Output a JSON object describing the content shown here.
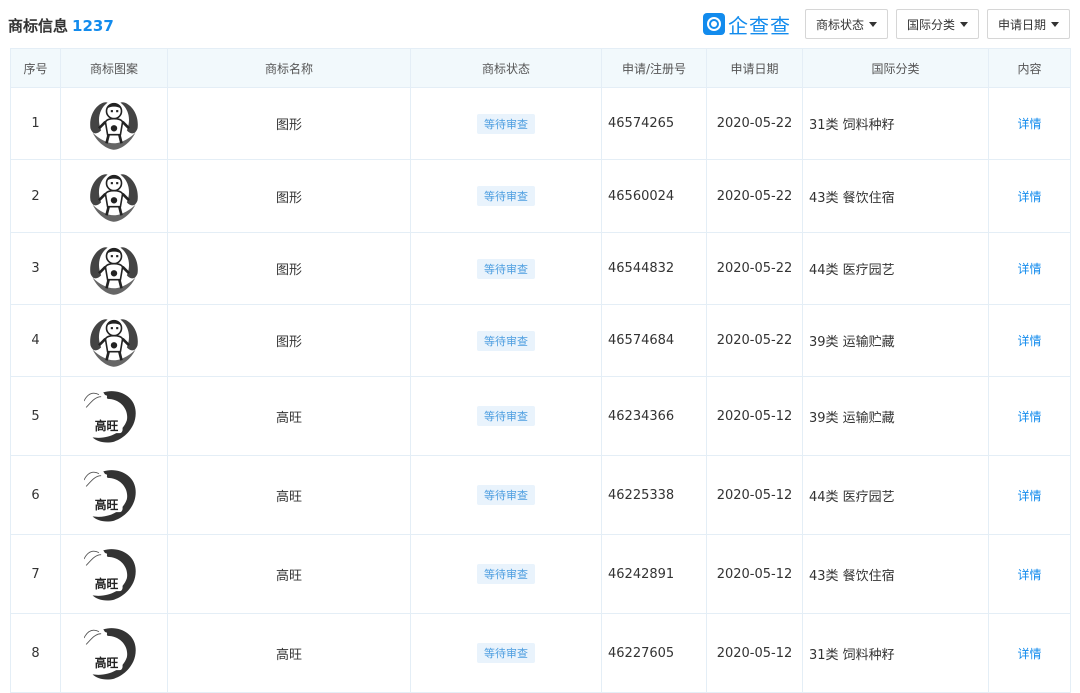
{
  "header": {
    "title": "商标信息",
    "count": "1237",
    "brand": "企查查",
    "filters": [
      {
        "label": "商标状态"
      },
      {
        "label": "国际分类"
      },
      {
        "label": "申请日期"
      }
    ]
  },
  "table": {
    "columns": [
      "序号",
      "商标图案",
      "商标名称",
      "商标状态",
      "申请/注册号",
      "申请日期",
      "国际分类",
      "内容"
    ],
    "rows": [
      {
        "no": "1",
        "logo": "figure-emblem-icon",
        "name": "图形",
        "status": "等待审查",
        "reg": "46574265",
        "date": "2020-05-22",
        "cls": "31类 饲料种籽",
        "action": "详情"
      },
      {
        "no": "2",
        "logo": "figure-emblem-icon",
        "name": "图形",
        "status": "等待审查",
        "reg": "46560024",
        "date": "2020-05-22",
        "cls": "43类 餐饮住宿",
        "action": "详情"
      },
      {
        "no": "3",
        "logo": "figure-emblem-icon",
        "name": "图形",
        "status": "等待审查",
        "reg": "46544832",
        "date": "2020-05-22",
        "cls": "44类 医疗园艺",
        "action": "详情"
      },
      {
        "no": "4",
        "logo": "figure-emblem-icon",
        "name": "图形",
        "status": "等待审查",
        "reg": "46574684",
        "date": "2020-05-22",
        "cls": "39类 运输贮藏",
        "action": "详情"
      },
      {
        "no": "5",
        "logo": "shrimp-emblem-icon",
        "name": "高旺",
        "status": "等待审查",
        "reg": "46234366",
        "date": "2020-05-12",
        "cls": "39类 运输贮藏",
        "action": "详情"
      },
      {
        "no": "6",
        "logo": "shrimp-emblem-icon",
        "name": "高旺",
        "status": "等待审查",
        "reg": "46225338",
        "date": "2020-05-12",
        "cls": "44类 医疗园艺",
        "action": "详情"
      },
      {
        "no": "7",
        "logo": "shrimp-emblem-icon",
        "name": "高旺",
        "status": "等待审查",
        "reg": "46242891",
        "date": "2020-05-12",
        "cls": "43类 餐饮住宿",
        "action": "详情"
      },
      {
        "no": "8",
        "logo": "shrimp-emblem-icon",
        "name": "高旺",
        "status": "等待审查",
        "reg": "46227605",
        "date": "2020-05-12",
        "cls": "31类 饲料种籽",
        "action": "详情"
      }
    ]
  },
  "shrimp_logo_text": "高旺"
}
